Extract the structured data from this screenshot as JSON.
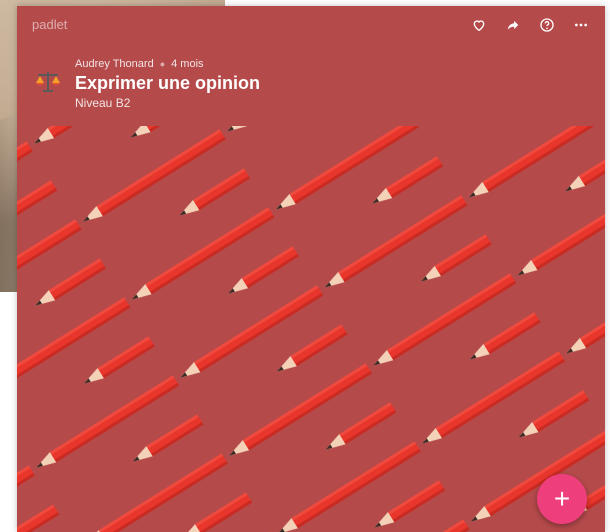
{
  "app": {
    "brand": "padlet"
  },
  "board": {
    "author": "Audrey Thonard",
    "age": "4 mois",
    "title": "Exprimer une opinion",
    "subtitle": "Niveau B2"
  },
  "toolbar": {
    "icons": [
      "heart-icon",
      "share-icon",
      "help-icon",
      "more-icon"
    ]
  },
  "fab": {
    "label": "+"
  },
  "colors": {
    "board_bg": "#b54a4b",
    "fab": "#ee3f7c",
    "pencil_body": "#e8362c",
    "pencil_eraser": "#f08db4",
    "pencil_wood": "#f3d2b8"
  }
}
